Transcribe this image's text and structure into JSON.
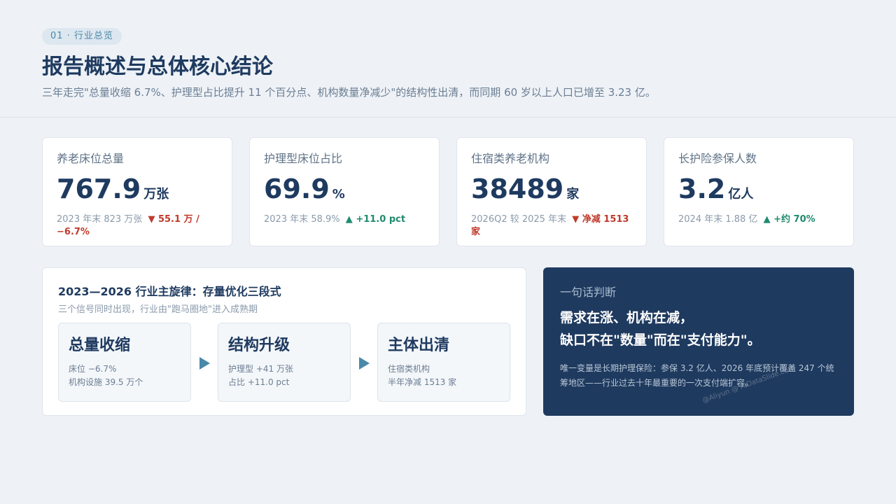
{
  "header": {
    "section_tag": "01 · 行业总览",
    "title": "报告概述与总体核心结论",
    "subtitle": "三年走完\"总量收缩 6.7%、护理型占比提升 11 个百分点、机构数量净减少\"的结构性出清，而同期 60 岁以上人口已增至 3.23 亿。"
  },
  "kpis": [
    {
      "label": "养老床位总量",
      "value": "767.9",
      "unit": "万张",
      "baseline": "2023 年末 823 万张",
      "delta": "▼ 55.1 万 / −6.7%",
      "direction": "down"
    },
    {
      "label": "护理型床位占比",
      "value": "69.9",
      "unit": "%",
      "baseline": "2023 年末 58.9%",
      "delta": "▲ +11.0 pct",
      "direction": "up"
    },
    {
      "label": "住宿类养老机构",
      "value": "38489",
      "unit": "家",
      "baseline": "2026Q2 较 2025 年末",
      "delta": "▼ 净减 1513 家",
      "direction": "down"
    },
    {
      "label": "长护险参保人数",
      "value": "3.2",
      "unit": "亿人",
      "baseline": "2024 年末 1.88 亿",
      "delta": "▲ +约 70%",
      "direction": "up"
    }
  ],
  "phases": {
    "title": "2023—2026 行业主旋律：存量优化三段式",
    "subtitle": "三个信号同时出现，行业由\"跑马圈地\"进入成熟期",
    "items": [
      {
        "name": "总量收缩",
        "line1": "床位 −6.7%",
        "line2": "机构设施 39.5 万个"
      },
      {
        "name": "结构升级",
        "line1": "护理型 +41 万张",
        "line2": "占比 +11.0 pct"
      },
      {
        "name": "主体出清",
        "line1": "住宿类机构",
        "line2": "半年净减 1513 家"
      }
    ]
  },
  "verdict": {
    "label": "一句话判断",
    "line1": "需求在涨、机构在减，",
    "line2": "缺口不在\"数量\"而在\"支付能力\"。",
    "note": "唯一变量是长期护理保险：参保 3.2 亿人、2026 年底预计覆盖 247 个统筹地区——行业过去十年最重要的一次支付端扩容。",
    "watermark": "@Aliyun @ AIDataSlide.com"
  },
  "colors": {
    "primary": "#1e3a5f",
    "accent": "#4a89a8",
    "down": "#c0392b",
    "up": "#1f8a6e",
    "background": "#eef2f7"
  }
}
